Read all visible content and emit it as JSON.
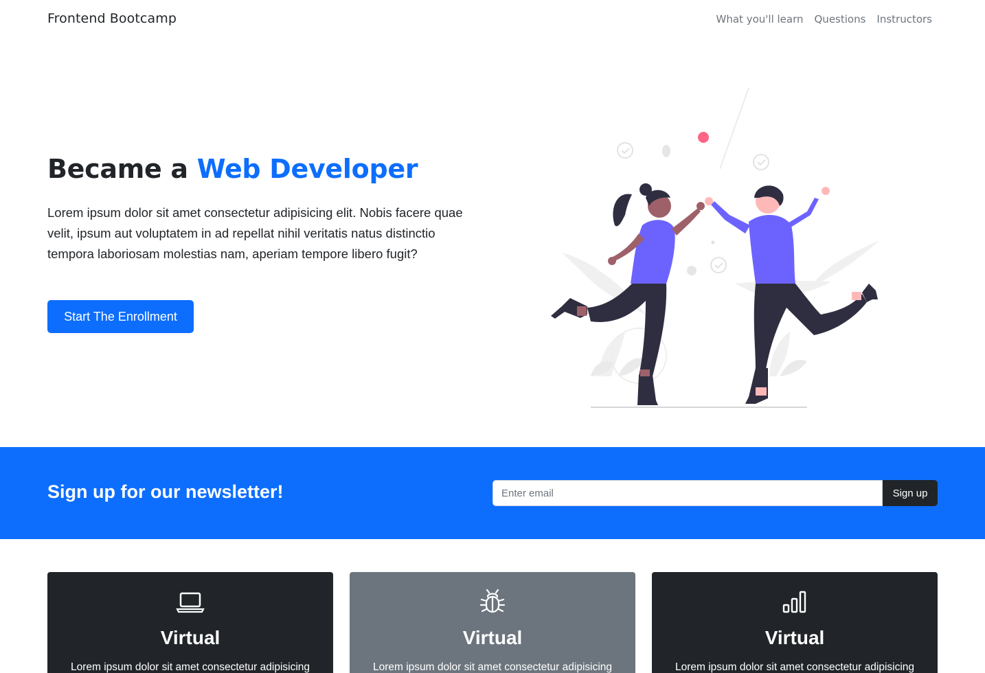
{
  "nav": {
    "brand": "Frontend Bootcamp",
    "links": [
      "What you'll learn",
      "Questions",
      "Instructors"
    ]
  },
  "hero": {
    "title_prefix": "Became a ",
    "title_accent": "Web Developer",
    "text": "Lorem ipsum dolor sit amet consectetur adipisicing elit. Nobis facere quae velit, ipsum aut voluptatem in ad repellat nihil veritatis natus distinctio tempora laboriosam molestias nam, aperiam tempore libero fugit?",
    "button_label": "Start The Enrollment",
    "illustration_icon": "high-five-illustration"
  },
  "newsletter": {
    "title": "Sign up for our newsletter!",
    "email_placeholder": "Enter email",
    "button_label": "Sign up"
  },
  "cards": [
    {
      "icon": "laptop-icon",
      "title": "Virtual",
      "text": "Lorem ipsum dolor sit amet consectetur adipisicing",
      "style": "dark"
    },
    {
      "icon": "bug-icon",
      "title": "Virtual",
      "text": "Lorem ipsum dolor sit amet consectetur adipisicing",
      "style": "secondary"
    },
    {
      "icon": "bar-chart-icon",
      "title": "Virtual",
      "text": "Lorem ipsum dolor sit amet consectetur adipisicing",
      "style": "dark"
    }
  ],
  "colors": {
    "primary": "#0d6efd",
    "dark": "#212529",
    "secondary": "#6c757d",
    "illustration_purple": "#6c63ff",
    "illustration_pink": "#ff6584"
  }
}
